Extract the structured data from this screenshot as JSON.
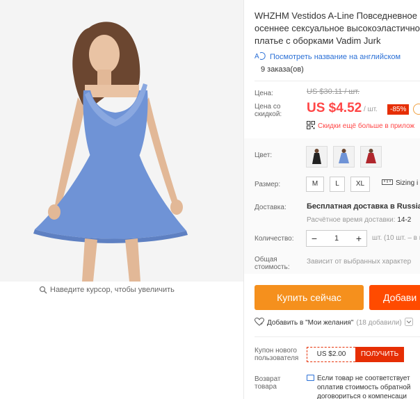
{
  "product": {
    "title_lines": [
      "WHZHM Vestidos A-Line Повседневное",
      "осеннее сексуальное высокоэластично",
      "платье с оборками Vadim Jurk"
    ],
    "translate_link": "Посмотреть название на английском",
    "orders": "9 заказа(ов)"
  },
  "gallery": {
    "zoom_hint": "Наведите курсор, чтобы увеличить"
  },
  "price": {
    "label": "Цена:",
    "old": "US $30.11 / шт.",
    "discount_label_1": "Цена со",
    "discount_label_2": "скидкой:",
    "new": "US $4.52",
    "per_unit": "/ шт.",
    "discount_badge": "-85%",
    "app_discount": "Скидки ещё больше в прилож"
  },
  "options": {
    "color_label": "Цвет:",
    "colors": [
      "black",
      "blue",
      "red"
    ],
    "size_label": "Размер:",
    "sizes": [
      "M",
      "L",
      "XL"
    ],
    "sizing_link": "Sizing i"
  },
  "shipping": {
    "label": "Доставка:",
    "free": "Бесплатная доставка в Russian",
    "est_prefix": "Расчётное время доставки:",
    "est_value": "14-2"
  },
  "quantity": {
    "label": "Количество:",
    "minus": "−",
    "value": "1",
    "plus": "+",
    "note": "шт. (10 шт. – в нали"
  },
  "total": {
    "label_1": "Общая",
    "label_2": "стоимость:",
    "note": "Зависит от выбранных характер"
  },
  "actions": {
    "buy_now": "Купить сейчас",
    "add_to_cart": "Добави",
    "wishlist": "Добавить в \"Мои желания\"",
    "wishlist_count": "(18 добавили)"
  },
  "coupon": {
    "label_1": "Купон нового",
    "label_2": "пользователя",
    "value": "US $2.00",
    "button": "ПОЛУЧИТЬ"
  },
  "returns": {
    "label_1": "Возврат",
    "label_2": "товара",
    "lines": [
      "Если товар не соответствует",
      "оплатив стоимость обратной",
      "договориться о компенсаци"
    ]
  },
  "colors": {
    "accent_red": "#ff4747",
    "buy_orange": "#f5901d",
    "cart_orange": "#ff4b00",
    "link_blue": "#2b70d6",
    "dress_blue": "#6f93d6"
  }
}
